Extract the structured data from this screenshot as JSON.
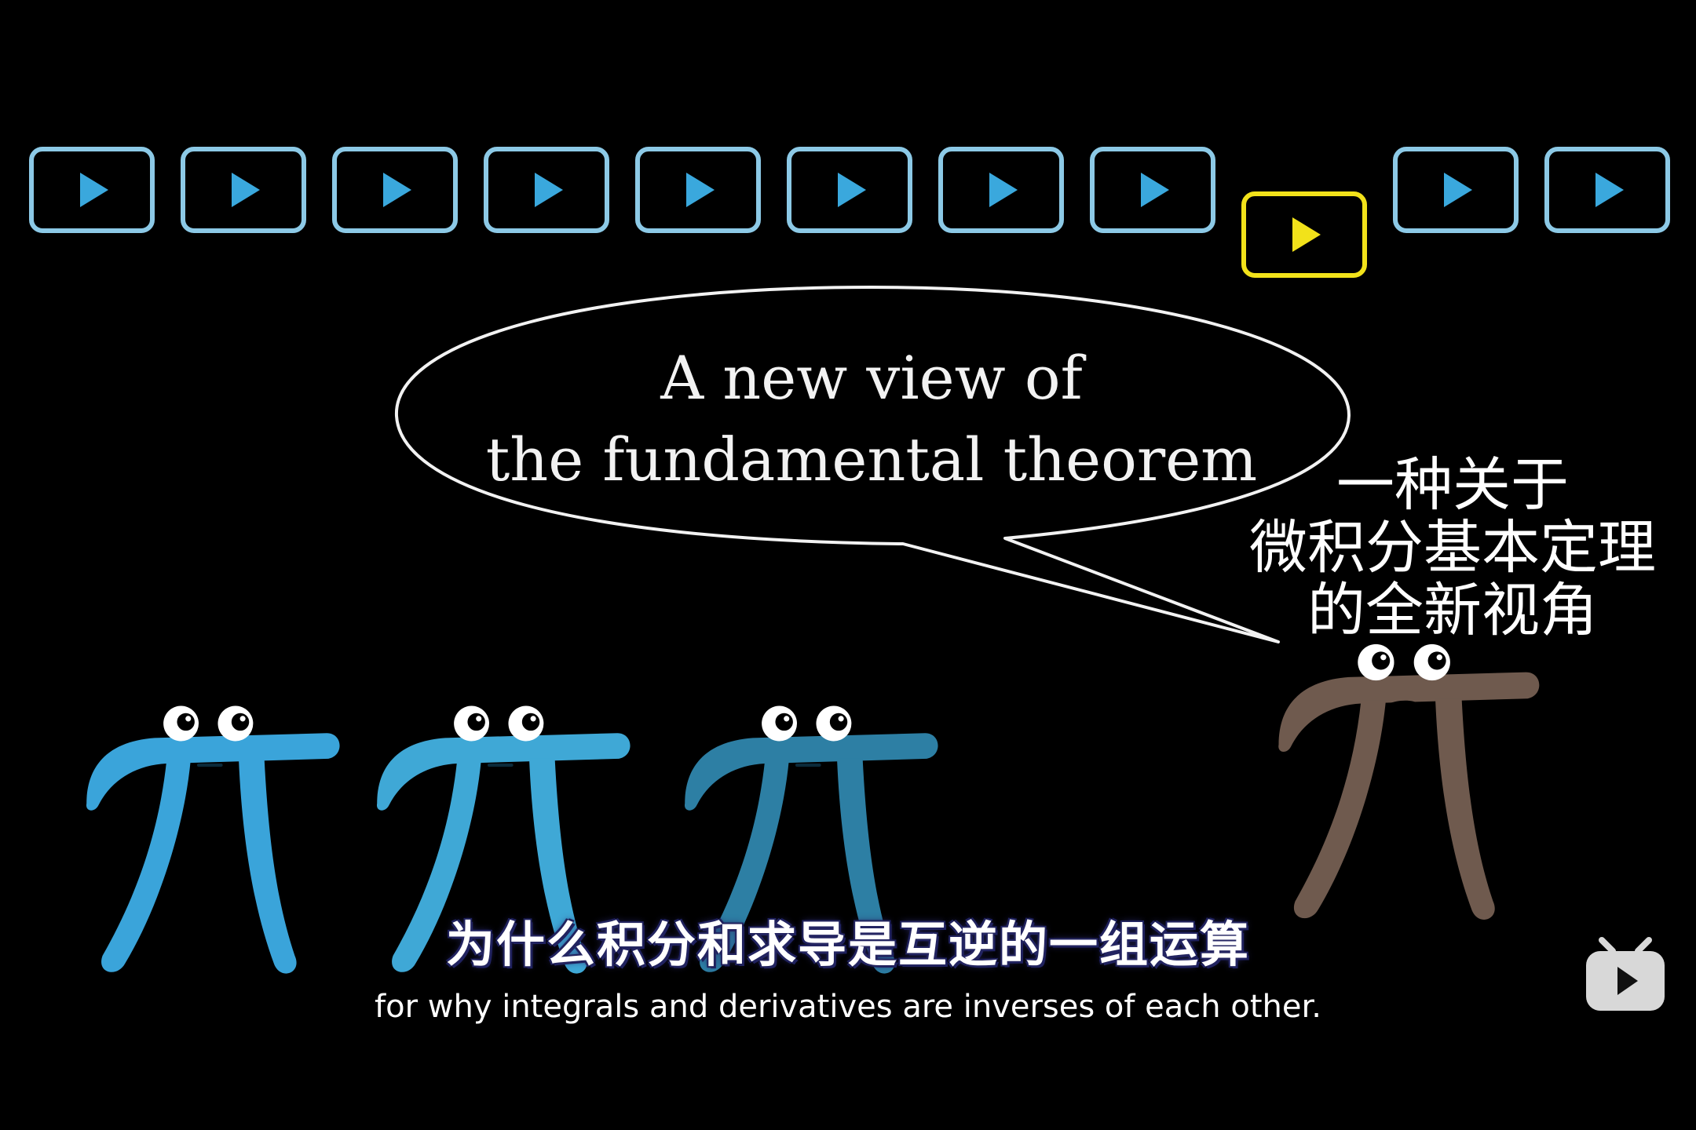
{
  "bubble": {
    "line1": "A new view of",
    "line2": "the fundamental theorem"
  },
  "annotation_cn": {
    "line1": "一种关于",
    "line2": "微积分基本定理",
    "line3": "的全新视角"
  },
  "subtitles": {
    "chinese": "为什么积分和求导是互逆的一组运算",
    "english": "for why integrals and derivatives are inverses of each other."
  },
  "playlist": {
    "count": 11,
    "highlighted_index": 8,
    "colors": {
      "normal": "#8cc9e6",
      "highlighted": "#f2e21a",
      "play": "#3aa8dd"
    }
  },
  "characters": {
    "blue_pis": [
      {
        "color": "#3aa4da"
      },
      {
        "color": "#3fa8d6"
      },
      {
        "color": "#2d7fa4"
      }
    ],
    "speaker_pi": {
      "color": "#6f5a4e"
    }
  },
  "watermark": {
    "icon": "bilibili-logo-icon"
  }
}
